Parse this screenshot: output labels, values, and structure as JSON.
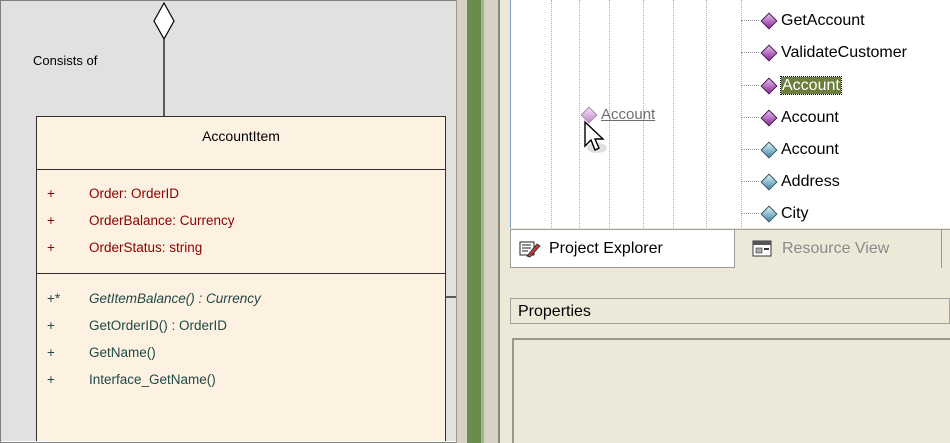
{
  "diagram": {
    "association_label": "Consists of",
    "class": {
      "name": "AccountItem",
      "attributes": [
        {
          "visibility": "+",
          "text": "Order:  OrderID"
        },
        {
          "visibility": "+",
          "text": "OrderBalance:  Currency"
        },
        {
          "visibility": "+",
          "text": "OrderStatus:  string"
        }
      ],
      "operations": [
        {
          "visibility": "+*",
          "text": "GetItemBalance() : Currency",
          "abstract": true
        },
        {
          "visibility": "+",
          "text": "GetOrderID() : OrderID",
          "abstract": false
        },
        {
          "visibility": "+",
          "text": "GetName()",
          "abstract": false
        },
        {
          "visibility": "+",
          "text": "Interface_GetName()",
          "abstract": false
        }
      ]
    }
  },
  "tree": {
    "drag_ghost_label": "Account",
    "items": [
      {
        "label": "GetAccount",
        "icon": "purple-gem-icon",
        "selected": false
      },
      {
        "label": "ValidateCustomer",
        "icon": "purple-gem-icon",
        "selected": false
      },
      {
        "label": "Account",
        "icon": "purple-gem-icon",
        "selected": true
      },
      {
        "label": "Account",
        "icon": "purple-gem-icon",
        "selected": false
      },
      {
        "label": "Account",
        "icon": "teal-gem-icon",
        "selected": false
      },
      {
        "label": "Address",
        "icon": "teal-gem-icon",
        "selected": false
      },
      {
        "label": "City",
        "icon": "teal-gem-icon",
        "selected": false
      }
    ]
  },
  "tabs": {
    "project_explorer": "Project Explorer",
    "resource_view": "Resource View"
  },
  "properties": {
    "label": "Properties"
  },
  "colors": {
    "class_fill": "#fdf1e2",
    "attribute_text": "#8b0000",
    "operation_text": "#1f4a46",
    "selection": "#6b7f3a",
    "splitter": "#6b8c4e"
  }
}
